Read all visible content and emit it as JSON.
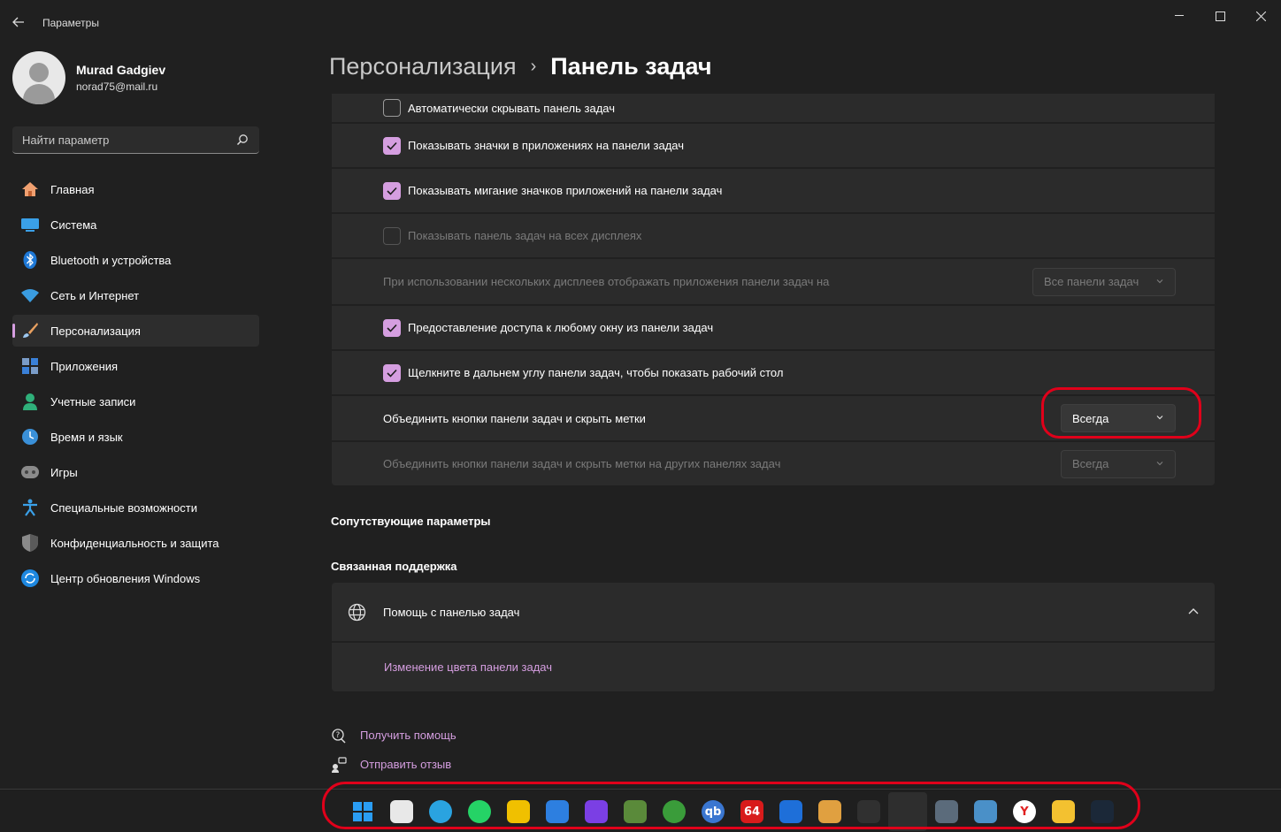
{
  "window": {
    "title": "Параметры"
  },
  "profile": {
    "name": "Murad Gadgiev",
    "email": "norad75@mail.ru"
  },
  "search": {
    "placeholder": "Найти параметр"
  },
  "sidebar": {
    "items": [
      {
        "label": "Главная",
        "icon": "home-icon"
      },
      {
        "label": "Система",
        "icon": "system-icon"
      },
      {
        "label": "Bluetooth и устройства",
        "icon": "bluetooth-icon"
      },
      {
        "label": "Сеть и Интернет",
        "icon": "wifi-icon"
      },
      {
        "label": "Персонализация",
        "icon": "brush-icon",
        "active": true
      },
      {
        "label": "Приложения",
        "icon": "apps-icon"
      },
      {
        "label": "Учетные записи",
        "icon": "accounts-icon"
      },
      {
        "label": "Время и язык",
        "icon": "time-language-icon"
      },
      {
        "label": "Игры",
        "icon": "gamepad-icon"
      },
      {
        "label": "Специальные возможности",
        "icon": "accessibility-icon"
      },
      {
        "label": "Конфиденциальность и защита",
        "icon": "shield-icon"
      },
      {
        "label": "Центр обновления Windows",
        "icon": "update-icon"
      }
    ]
  },
  "breadcrumb": {
    "parent": "Персонализация",
    "separator": "›",
    "current": "Панель задач"
  },
  "settings": {
    "auto_hide": {
      "label": "Автоматически скрывать панель задач",
      "checked": false
    },
    "badges": {
      "label": "Показывать значки в приложениях на панели задач",
      "checked": true
    },
    "flashing": {
      "label": "Показывать мигание значков приложений на панели задач",
      "checked": true
    },
    "all_displays": {
      "label": "Показывать панель задач на всех дисплеях",
      "checked": false,
      "disabled": true
    },
    "multi_display_apps": {
      "label": "При использовании нескольких дисплеев отображать приложения панели задач на",
      "value": "Все панели задач",
      "disabled": true
    },
    "share_window": {
      "label": "Предоставление доступа к любому окну из панели задач",
      "checked": true
    },
    "show_desktop": {
      "label": "Щелкните в дальнем углу панели задач, чтобы показать рабочий стол",
      "checked": true
    },
    "combine": {
      "label": "Объединить кнопки панели задач и скрыть метки",
      "value": "Всегда"
    },
    "combine_other": {
      "label": "Объединить кнопки панели задач и скрыть метки на других панелях задач",
      "value": "Всегда",
      "disabled": true
    }
  },
  "sections": {
    "related": "Сопутствующие параметры",
    "support": "Связанная поддержка"
  },
  "support": {
    "title": "Помощь с панелью задач",
    "link": "Изменение цвета панели задач"
  },
  "footer": {
    "get_help": "Получить помощь",
    "feedback": "Отправить отзыв"
  },
  "taskbar": {
    "icons": [
      {
        "name": "start-icon",
        "color": "#1e90ff",
        "text": ""
      },
      {
        "name": "store-icon",
        "color": "#e8e8e8",
        "text": ""
      },
      {
        "name": "telegram-icon",
        "color": "#2aa3e0",
        "text": ""
      },
      {
        "name": "whatsapp-icon",
        "color": "#25d366",
        "text": ""
      },
      {
        "name": "app-yellow-icon",
        "color": "#f0c000",
        "text": ""
      },
      {
        "name": "app-blue-icon",
        "color": "#2d7fe0",
        "text": ""
      },
      {
        "name": "app-purple-icon",
        "color": "#7b3fe4",
        "text": ""
      },
      {
        "name": "gpu-icon",
        "color": "#5a8a3a",
        "text": ""
      },
      {
        "name": "xbox-icon",
        "color": "#3a9c3a",
        "text": ""
      },
      {
        "name": "qbittorrent-icon",
        "color": "#3a76d0",
        "text": "qb"
      },
      {
        "name": "aida64-icon",
        "color": "#d81b1b",
        "text": "64"
      },
      {
        "name": "app-bars-icon",
        "color": "#1e6fd9",
        "text": ""
      },
      {
        "name": "app-leaf-icon",
        "color": "#e0a040",
        "text": ""
      },
      {
        "name": "terminal-icon",
        "color": "#303030",
        "text": ""
      },
      {
        "name": "settings-active-icon",
        "color": "#2e2e2e",
        "text": "",
        "active": true
      },
      {
        "name": "calculator-icon",
        "color": "#5b6b7b",
        "text": ""
      },
      {
        "name": "monitor-icon",
        "color": "#4a90c8",
        "text": ""
      },
      {
        "name": "yandex-icon",
        "color": "#ffffff",
        "text": "Y"
      },
      {
        "name": "explorer-icon",
        "color": "#f3c130",
        "text": ""
      },
      {
        "name": "steam-icon",
        "color": "#1b2838",
        "text": ""
      }
    ]
  },
  "colors": {
    "accent": "#d59ee0",
    "highlight": "#e0001a"
  }
}
